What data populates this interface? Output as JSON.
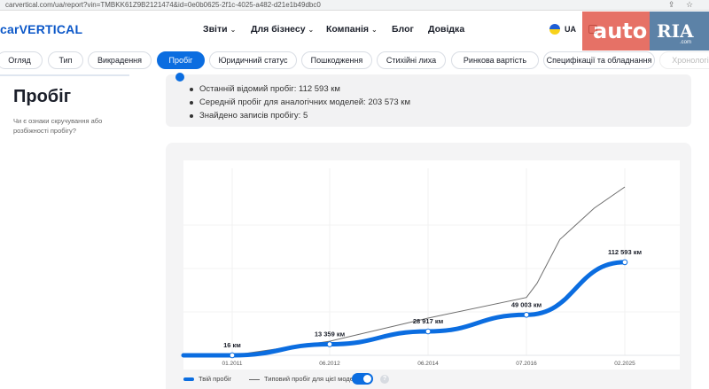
{
  "browser": {
    "url": "carvertical.com/ua/report?vin=TMBKK61Z9B2121474&id=0e0b0625-2f1c-4025-a482-d21e1b49dbc0"
  },
  "brand": {
    "logo_text": "carVERTICAL",
    "accent": "#0b6de0"
  },
  "nav": {
    "items": [
      {
        "label": "Звіти",
        "has_chevron": true
      },
      {
        "label": "Для бізнесу",
        "has_chevron": true
      },
      {
        "label": "Компанія",
        "has_chevron": true
      },
      {
        "label": "Блог",
        "has_chevron": false
      },
      {
        "label": "Довідка",
        "has_chevron": false
      }
    ],
    "lang": "UA",
    "chevron": "⌄"
  },
  "watermark": {
    "left": "auto",
    "right": "RIA",
    "sub": ".com"
  },
  "tabs": [
    {
      "label": "Огляд",
      "active": false
    },
    {
      "label": "Тип",
      "active": false
    },
    {
      "label": "Викрадення",
      "active": false
    },
    {
      "label": "Пробіг",
      "active": true
    },
    {
      "label": "Юридичний статус",
      "active": false
    },
    {
      "label": "Пошкодження",
      "active": false
    },
    {
      "label": "Стихійні лиха",
      "active": false
    },
    {
      "label": "Ринкова вартість",
      "active": false
    },
    {
      "label": "Специфікації та обладнання",
      "active": false
    },
    {
      "label": "Хронологі",
      "active": false
    }
  ],
  "section": {
    "title": "Пробіг",
    "subtitle": "Чи є ознаки скручування або розбіжності пробігу?"
  },
  "summary": {
    "items": [
      "Останній відомий пробіг: 112 593 км",
      "Середній пробіг для аналогічних моделей: 203 573 км",
      "Знайдено записів пробігу: 5"
    ]
  },
  "chart_data": {
    "type": "line",
    "x": [
      "01.2011",
      "06.2012",
      "06.2014",
      "07.2016",
      "02.2025"
    ],
    "series": [
      {
        "name": "Твій пробіг",
        "color": "#0b6de0",
        "points": [
          {
            "date": "2011-01",
            "value": 16,
            "label": "16 км"
          },
          {
            "date": "2012-06",
            "value": 13359,
            "label": "13 359 км"
          },
          {
            "date": "2014-06",
            "value": 28917,
            "label": "28 917 км"
          },
          {
            "date": "2016-07",
            "value": 49003,
            "label": "49 003 км"
          },
          {
            "date": "2025-02",
            "value": 112593,
            "label": "112 593 км"
          }
        ]
      },
      {
        "name": "Типовий пробіг для цієї моделі",
        "color": "#6e6e6e",
        "points": [
          {
            "date": "2011-01",
            "value": 0
          },
          {
            "date": "2012-06",
            "value": 17000
          },
          {
            "date": "2014-06",
            "value": 45000
          },
          {
            "date": "2016-07",
            "value": 70000
          },
          {
            "date": "2017-06",
            "value": 87000
          },
          {
            "date": "2019-06",
            "value": 140000
          },
          {
            "date": "2022-06",
            "value": 178000
          },
          {
            "date": "2025-02",
            "value": 203573
          }
        ]
      }
    ],
    "ylim": [
      0,
      210000
    ],
    "grid": true,
    "legend": "bottom-left"
  }
}
